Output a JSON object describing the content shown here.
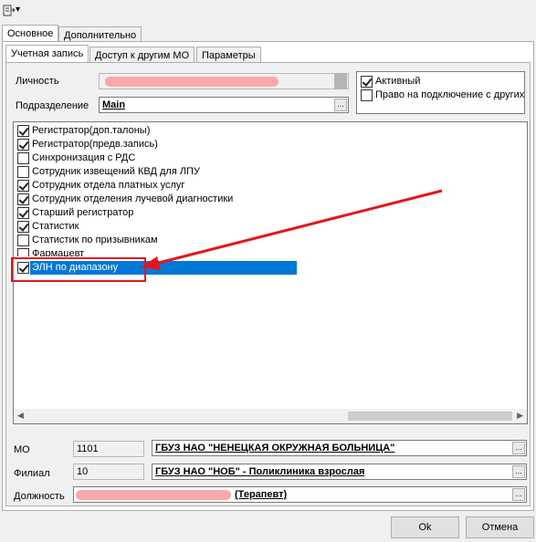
{
  "toolbar": {
    "icon": "form-icon",
    "dropdown_glyph": "▾"
  },
  "main_tabs": [
    {
      "label": "Основное"
    },
    {
      "label": "Дополнительно"
    }
  ],
  "sub_tabs": [
    {
      "label": "Учетная запись"
    },
    {
      "label": "Доступ к другим МО"
    },
    {
      "label": "Параметры"
    }
  ],
  "account": {
    "person_label": "Личность",
    "department_label": "Подразделение",
    "department_value": "Main",
    "ellipsis": "..."
  },
  "flags": [
    {
      "label": "Активный",
      "checked": true
    },
    {
      "label": "Право на подключение с других",
      "checked": false
    }
  ],
  "roles": [
    {
      "label": "Регистратор(доп.талоны)",
      "checked": true
    },
    {
      "label": "Регистратор(предв.запись)",
      "checked": true
    },
    {
      "label": "Синхронизация с РДС",
      "checked": false
    },
    {
      "label": "Сотрудник извещений КВД для ЛПУ",
      "checked": false
    },
    {
      "label": "Сотрудник отдела платных услуг",
      "checked": true
    },
    {
      "label": "Сотрудник отделения лучевой диагностики",
      "checked": true
    },
    {
      "label": "Старший регистратор",
      "checked": true
    },
    {
      "label": "Статистик",
      "checked": true
    },
    {
      "label": "Статистик по призывникам",
      "checked": false
    },
    {
      "label": "Фармацевт",
      "checked": false
    },
    {
      "label": "ЭЛН по диапазону",
      "checked": true,
      "selected": true
    }
  ],
  "bottom": {
    "mo_label": "МО",
    "mo_code": "1101",
    "mo_name": "ГБУЗ НАО \"НЕНЕЦКАЯ ОКРУЖНАЯ БОЛЬНИЦА\"",
    "branch_label": "Филиал",
    "branch_code": "10",
    "branch_name": "ГБУЗ НАО \"НОБ\" - Поликлиника взрослая",
    "position_label": "Должность",
    "position_value": "(Терапевт)",
    "ellipsis": "..."
  },
  "buttons": {
    "ok": "Ok",
    "cancel": "Отмена"
  },
  "colors": {
    "selection": "#0078d7",
    "annotation": "#e8141c"
  }
}
